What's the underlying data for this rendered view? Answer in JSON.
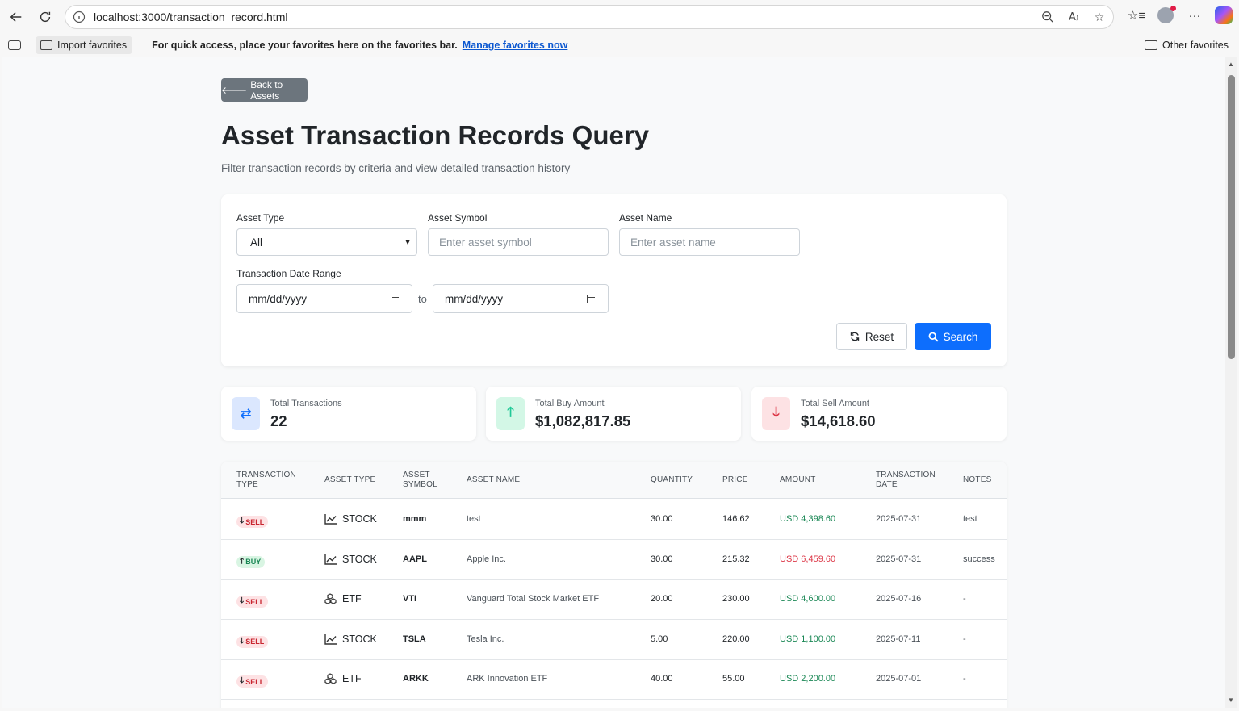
{
  "browser": {
    "url": "localhost:3000/transaction_record.html",
    "favorites_bar": {
      "import_label": "Import favorites",
      "message": "For quick access, place your favorites here on the favorites bar.",
      "manage_link": "Manage favorites now",
      "other_favorites": "Other favorites"
    }
  },
  "page": {
    "back_label": "Back to Assets",
    "title": "Asset Transaction Records Query",
    "subtitle": "Filter transaction records by criteria and view detailed transaction history"
  },
  "filters": {
    "asset_type_label": "Asset Type",
    "asset_type_value": "All",
    "asset_symbol_label": "Asset Symbol",
    "asset_symbol_placeholder": "Enter asset symbol",
    "asset_name_label": "Asset Name",
    "asset_name_placeholder": "Enter asset name",
    "date_range_label": "Transaction Date Range",
    "date_from": "mm/dd/yyyy",
    "to_label": "to",
    "date_to": "mm/dd/yyyy",
    "reset_label": "Reset",
    "search_label": "Search"
  },
  "stats": [
    {
      "label": "Total Transactions",
      "value": "22",
      "icon": "exchange-icon",
      "color": "#0d6efd"
    },
    {
      "label": "Total Buy Amount",
      "value": "$1,082,817.85",
      "icon": "arrow-up-icon",
      "color": "#20c997"
    },
    {
      "label": "Total Sell Amount",
      "value": "$14,618.60",
      "icon": "arrow-down-icon",
      "color": "#dc3545"
    }
  ],
  "table": {
    "headers": [
      "TRANSACTION TYPE",
      "ASSET TYPE",
      "ASSET SYMBOL",
      "ASSET NAME",
      "QUANTITY",
      "PRICE",
      "AMOUNT",
      "TRANSACTION DATE",
      "NOTES"
    ],
    "rows": [
      {
        "type": "SELL",
        "asset_type": "STOCK",
        "symbol": "mmm",
        "name": "test",
        "quantity": "30.00",
        "price": "146.62",
        "amount": "USD 4,398.60",
        "date": "2025-07-31",
        "notes": "test"
      },
      {
        "type": "BUY",
        "asset_type": "STOCK",
        "symbol": "AAPL",
        "name": "Apple Inc.",
        "quantity": "30.00",
        "price": "215.32",
        "amount": "USD 6,459.60",
        "date": "2025-07-31",
        "notes": "success"
      },
      {
        "type": "SELL",
        "asset_type": "ETF",
        "symbol": "VTI",
        "name": "Vanguard Total Stock Market ETF",
        "quantity": "20.00",
        "price": "230.00",
        "amount": "USD 4,600.00",
        "date": "2025-07-16",
        "notes": "-"
      },
      {
        "type": "SELL",
        "asset_type": "STOCK",
        "symbol": "TSLA",
        "name": "Tesla Inc.",
        "quantity": "5.00",
        "price": "220.00",
        "amount": "USD 1,100.00",
        "date": "2025-07-11",
        "notes": "-"
      },
      {
        "type": "SELL",
        "asset_type": "ETF",
        "symbol": "ARKK",
        "name": "ARK Innovation ETF",
        "quantity": "40.00",
        "price": "55.00",
        "amount": "USD 2,200.00",
        "date": "2025-07-01",
        "notes": "-"
      }
    ]
  },
  "colors": {
    "primary": "#0d6efd",
    "secondary": "#6c757d",
    "sell_amount": "#198754",
    "buy_amount": "#dc3545"
  }
}
